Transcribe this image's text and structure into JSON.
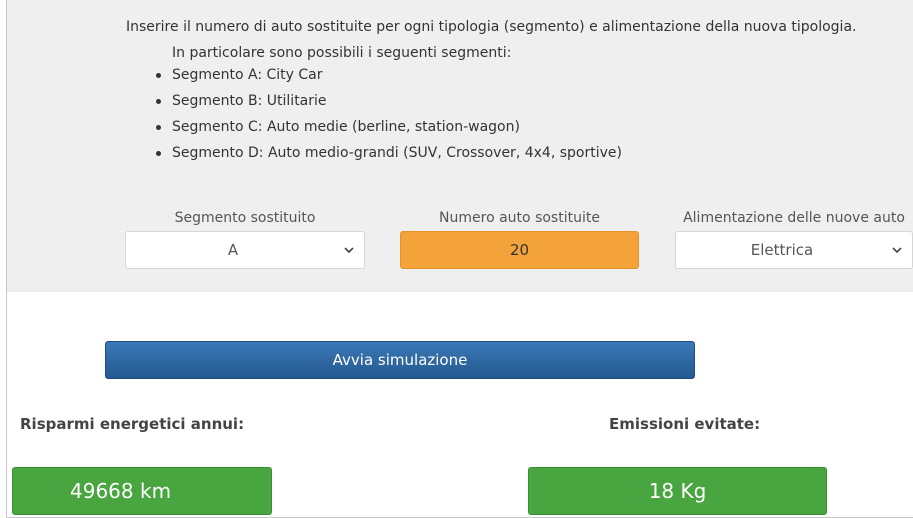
{
  "intro": {
    "line1": "Inserire il numero di auto sostituite per ogni tipologia (segmento) e alimentazione della nuova tipologia.",
    "line2": "In particolare sono possibili i seguenti segmenti:",
    "segments": [
      "Segmento A: City Car",
      "Segmento B: Utilitarie",
      "Segmento C: Auto medie (berline, station-wagon)",
      "Segmento D: Auto medio-grandi (SUV, Crossover, 4x4, sportive)"
    ]
  },
  "form": {
    "segment_label": "Segmento sostituito",
    "segment_value": "A",
    "count_label": "Numero auto sostituite",
    "count_value": "20",
    "fuel_label": "Alimentazione delle nuove auto",
    "fuel_value": "Elettrica"
  },
  "actions": {
    "run_label": "Avvia simulazione"
  },
  "results": {
    "savings_label": "Risparmi energetici annui:",
    "savings_value": "49668 km",
    "emissions_label": "Emissioni evitate:",
    "emissions_value": "18 Kg"
  },
  "colors": {
    "panel": "#efefef",
    "input_accent": "#f4a23a",
    "button": "#2f6aa6",
    "result": "#49a53f"
  }
}
